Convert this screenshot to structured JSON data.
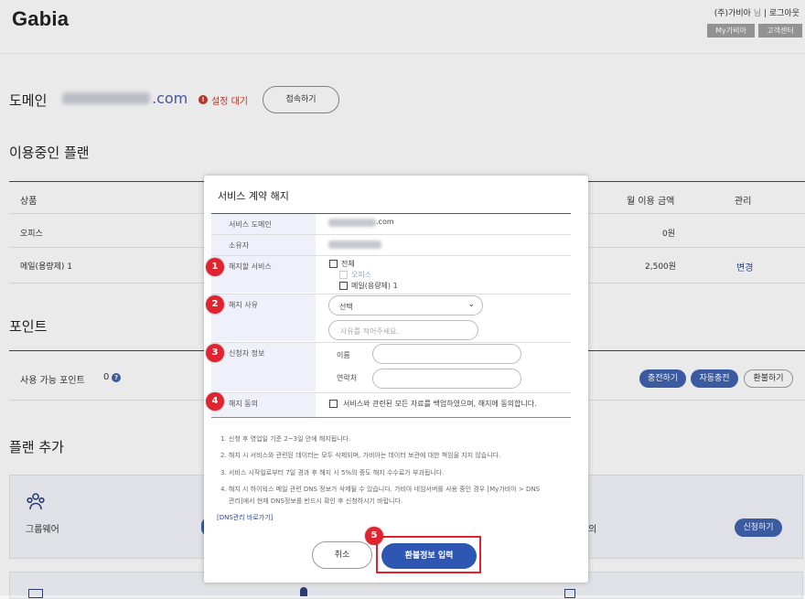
{
  "header": {
    "logo": "Gabia",
    "user_name": "(주)가비아",
    "user_suffix": "님",
    "separator": "|",
    "logout": "로그아웃",
    "my_gabia": "My가비아",
    "customer_center": "고객센터"
  },
  "domain": {
    "label": "도메인",
    "tld": ".com",
    "status_icon": "!",
    "status": "설정 대기",
    "connect_button": "접속하기"
  },
  "plans": {
    "title": "이용중인 플랜",
    "col_product": "상품",
    "col_monthly": "월 이용 금액",
    "col_manage": "관리",
    "rows": [
      {
        "product": "오피스",
        "amount": "0원",
        "manage": ""
      },
      {
        "product": "메일(용량제) 1",
        "amount": "2,500원",
        "manage": "변경"
      }
    ]
  },
  "points": {
    "title": "포인트",
    "label": "사용 가능 포인트",
    "value": "0",
    "help_icon": "?",
    "charge": "충전하기",
    "auto_charge": "자동충전",
    "refund": "환불하기"
  },
  "add_plan": {
    "title": "플랜 추가",
    "groupware": "그룹웨어",
    "partial_text": "의",
    "apply": "신청하기"
  },
  "modal": {
    "title": "서비스 계약 해지",
    "service_domain_label": "서비스 도메인",
    "service_domain_tld": ".com",
    "owner_label": "소유자",
    "cancel_service_label": "해지할 서비스",
    "opt_all": "전체",
    "opt_office": "오피스",
    "opt_mail": "메일(용량제) 1",
    "reason_label": "해지 사유",
    "reason_select": "선택",
    "reason_placeholder": "사유를 적어주세요.",
    "applicant_label": "신청자 정보",
    "name_label": "이름",
    "contact_label": "연락처",
    "agree_label": "해지 동의",
    "agree_text": "서비스와 관련된 모든 자료를 백업하였으며, 해지에 동의합니다.",
    "notes": [
      "1. 신청 후 영업일 기준 2~3일 안에 해지됩니다.",
      "2. 해지 시 서비스와 관련된 데이터는 모두 삭제되며, 가비아는 데이터 보관에 대한 책임을 지지 않습니다.",
      "3. 서비스 시작일로부터 7일 경과 후 해지 시 5%의 중도 해지 수수료가 부과됩니다.",
      "4. 해지 시 하이웍스 메일 관련 DNS 정보가 삭제될 수 있습니다. 가비아 네임서버를 사용 중인 경우 [My가비아 > DNS",
      "관리]에서 현재 DNS정보를 반드시 확인 후 신청하시기 바랍니다."
    ],
    "dns_link": "[DNS관리 바로가기]",
    "cancel_button": "취소",
    "refund_button": "환불정보 입력"
  },
  "badges": [
    "1",
    "2",
    "3",
    "4",
    "5"
  ],
  "colors": {
    "badge_red": "#e0232e",
    "primary_blue": "#2e56b3",
    "status_red": "#c0392b"
  }
}
